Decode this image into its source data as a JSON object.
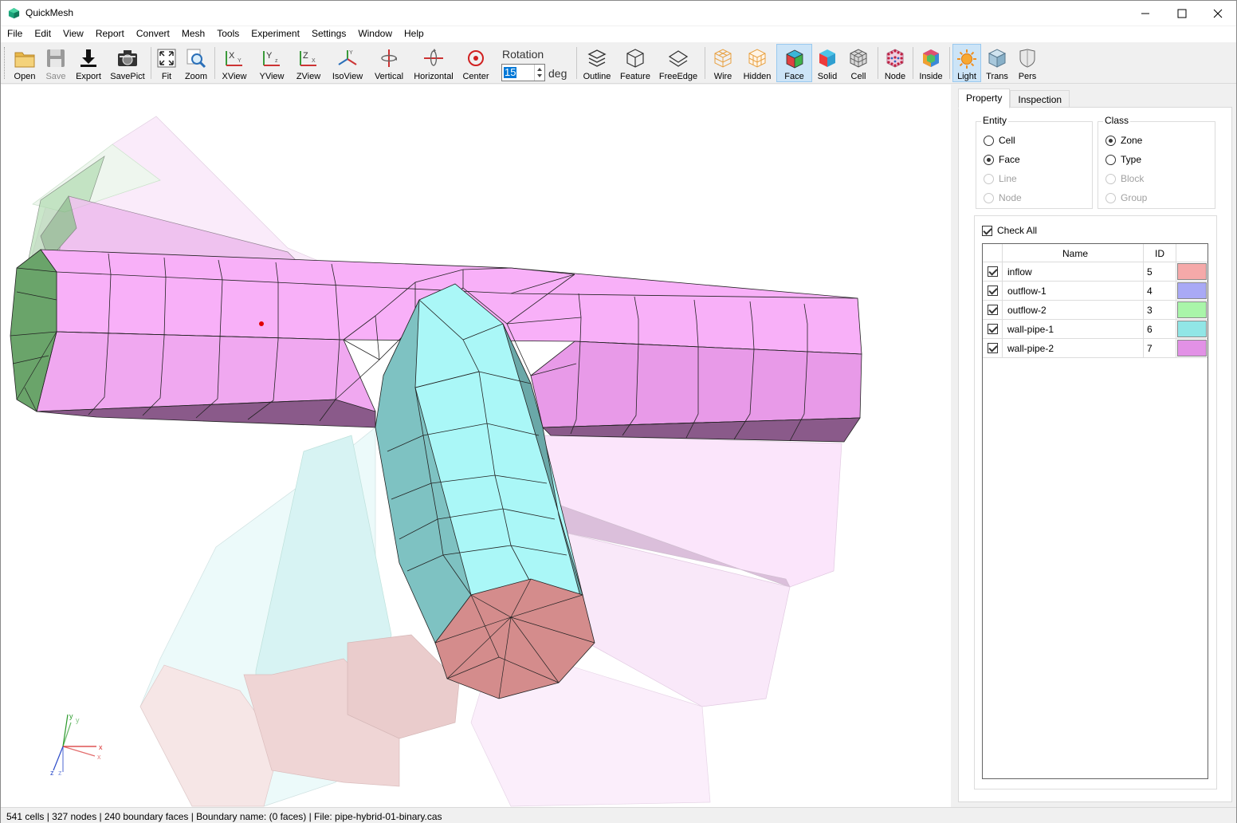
{
  "window": {
    "title": "QuickMesh"
  },
  "menu": [
    "File",
    "Edit",
    "View",
    "Report",
    "Convert",
    "Mesh",
    "Tools",
    "Experiment",
    "Settings",
    "Window",
    "Help"
  ],
  "toolbar": {
    "open": "Open",
    "save": "Save",
    "export": "Export",
    "savepict": "SavePict",
    "fit": "Fit",
    "zoom": "Zoom",
    "xview": "XView",
    "yview": "YView",
    "zview": "ZView",
    "isoview": "IsoView",
    "vertical": "Vertical",
    "horizontal": "Horizontal",
    "center": "Center",
    "rotation_label": "Rotation",
    "rotation_value": "15",
    "rotation_unit": "deg",
    "outline": "Outline",
    "feature": "Feature",
    "freeedge": "FreeEdge",
    "wire": "Wire",
    "hidden": "Hidden",
    "face": "Face",
    "solid": "Solid",
    "cell": "Cell",
    "node": "Node",
    "inside": "Inside",
    "light": "Light",
    "trans": "Trans",
    "pers": "Pers"
  },
  "panel": {
    "tabs": [
      "Property",
      "Inspection"
    ],
    "entity": {
      "title": "Entity",
      "options": [
        "Cell",
        "Face",
        "Line",
        "Node"
      ],
      "selected": "Face"
    },
    "class": {
      "title": "Class",
      "options": [
        "Zone",
        "Type",
        "Block",
        "Group"
      ],
      "selected": "Zone"
    },
    "check_all": "Check All",
    "grid": {
      "headers": [
        "Name",
        "ID"
      ],
      "rows": [
        {
          "name": "inflow",
          "id": "5",
          "color": "#f5a9a9"
        },
        {
          "name": "outflow-1",
          "id": "4",
          "color": "#a9a9f5"
        },
        {
          "name": "outflow-2",
          "id": "3",
          "color": "#a9f5a9"
        },
        {
          "name": "wall-pipe-1",
          "id": "6",
          "color": "#91e6e6"
        },
        {
          "name": "wall-pipe-2",
          "id": "7",
          "color": "#e291e6"
        }
      ]
    }
  },
  "status": "541 cells | 327 nodes | 240 boundary faces |  Boundary name:  (0 faces) | File: pipe-hybrid-01-binary.cas",
  "axis_labels": {
    "y": "y",
    "x": "x",
    "z": "z"
  }
}
